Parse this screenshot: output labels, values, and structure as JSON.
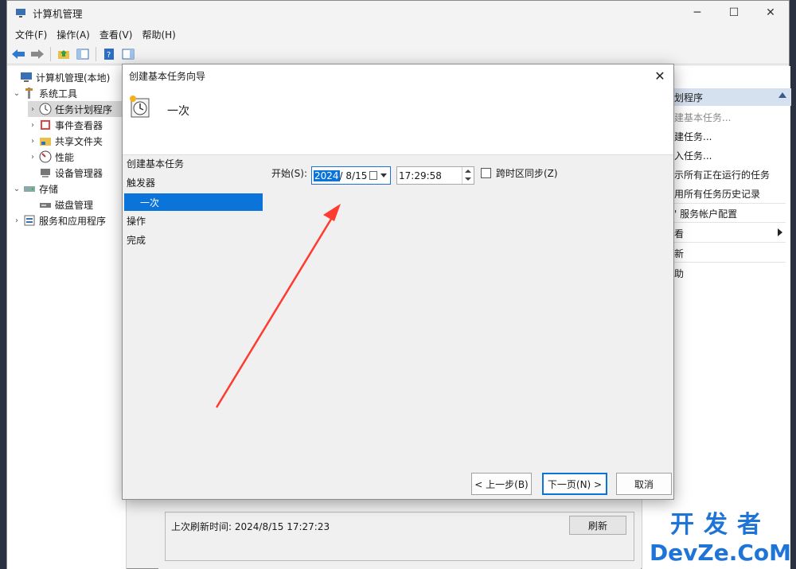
{
  "window": {
    "title": "计算机管理",
    "controls": [
      "─",
      "☐",
      "✕"
    ]
  },
  "menubar": [
    "文件(F)",
    "操作(A)",
    "查看(V)",
    "帮助(H)"
  ],
  "tree": {
    "root": "计算机管理(本地)",
    "items": [
      {
        "label": "系统工具",
        "icon": "tools-icon"
      },
      {
        "label": "任务计划程序",
        "icon": "clock-icon"
      },
      {
        "label": "事件查看器",
        "icon": "event-viewer-icon"
      },
      {
        "label": "共享文件夹",
        "icon": "shared-folder-icon"
      },
      {
        "label": "性能",
        "icon": "performance-icon"
      },
      {
        "label": "设备管理器",
        "icon": "device-manager-icon"
      },
      {
        "label": "存储",
        "icon": "storage-icon"
      },
      {
        "label": "磁盘管理",
        "icon": "disk-icon"
      },
      {
        "label": "服务和应用程序",
        "icon": "services-icon"
      }
    ]
  },
  "main": {
    "last_refresh": "上次刷新时间: 2024/8/15 17:27:23",
    "refresh_label": "刷新"
  },
  "actions": {
    "header": "划程序",
    "items": [
      "建基本任务...",
      "建任务...",
      "入任务...",
      "示所有正在运行的任务",
      "用所有任务历史记录",
      "' 服务帐户配置",
      "看",
      "新",
      "助"
    ]
  },
  "dialog": {
    "title": "创建基本任务向导",
    "header": "一次",
    "steps": [
      "创建基本任务",
      "触发器",
      "一次",
      "操作",
      "完成"
    ],
    "start_label": "开始(S):",
    "date_selected": "2024",
    "date_rest": "/  8/15",
    "time_value": "17:29:58",
    "sync_label": "跨时区同步(Z)",
    "btn_back": "< 上一步(B)",
    "btn_next": "下一页(N) >",
    "btn_cancel": "取消"
  },
  "watermark": {
    "line1": "开发者",
    "line2": "DevZe.CoM"
  },
  "colors": {
    "accent": "#0a74da",
    "arrow": "#ff3b30",
    "watermark": "#1f74d8"
  }
}
